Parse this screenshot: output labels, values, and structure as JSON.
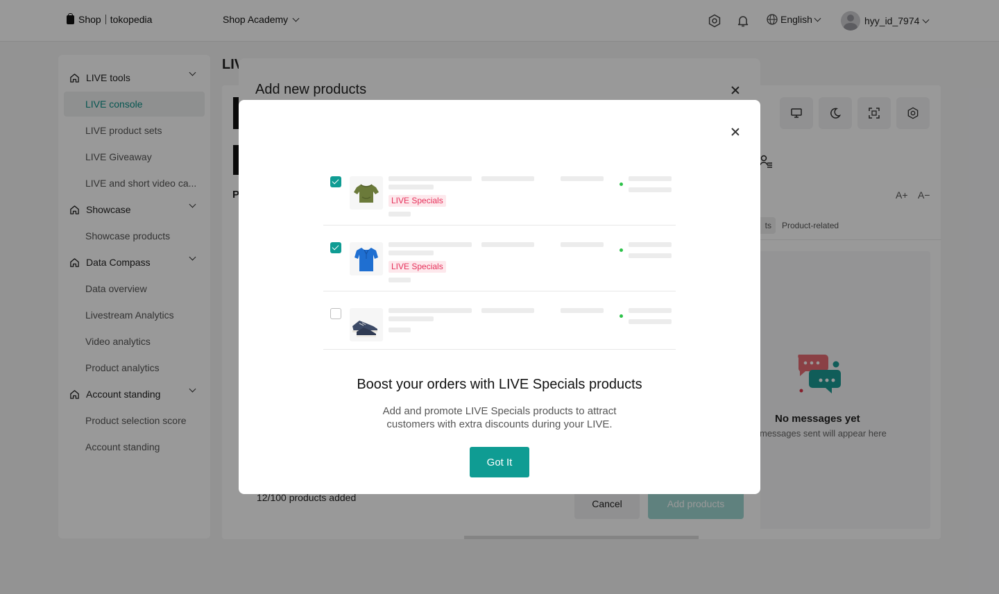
{
  "topbar": {
    "logo_shop": "Shop",
    "logo_partner": "tokopedia",
    "academy_label": "Shop Academy",
    "language": "English",
    "username": "hyy_id_7974",
    "icons": [
      "settings-icon",
      "bell-icon",
      "globe-icon",
      "avatar"
    ]
  },
  "sidebar": {
    "groups": [
      {
        "label": "LIVE tools",
        "items": [
          "LIVE console",
          "LIVE product sets",
          "LIVE Giveaway",
          "LIVE and short video ca..."
        ]
      },
      {
        "label": "Showcase",
        "items": [
          "Showcase products"
        ]
      },
      {
        "label": "Data Compass",
        "items": [
          "Data overview",
          "Livestream Analytics",
          "Video analytics",
          "Product analytics"
        ]
      },
      {
        "label": "Account standing",
        "items": [
          "Product selection score",
          "Account standing"
        ]
      }
    ],
    "active_item": "LIVE console"
  },
  "page": {
    "title_partial": "LIV",
    "left_letter": "P",
    "font_increase": "A+",
    "font_decrease": "A−",
    "tab_partial": "ts",
    "tab_product_related": "Product-related",
    "no_messages_title": "No messages yet",
    "no_messages_sub": "messages sent will appear here"
  },
  "dialog": {
    "title": "Add new products",
    "added_count": "12/100 products added",
    "cancel_label": "Cancel",
    "add_label": "Add products"
  },
  "modal": {
    "rows": [
      {
        "checked": true,
        "image": "green-tshirt",
        "tag": "LIVE Specials"
      },
      {
        "checked": true,
        "image": "blue-polo-shirt",
        "tag": "LIVE Specials"
      },
      {
        "checked": false,
        "image": "sneakers",
        "tag": ""
      }
    ],
    "title": "Boost your orders with LIVE Specials products",
    "description": "Add and promote LIVE Specials products to attract customers with extra discounts during your LIVE.",
    "button_label": "Got It"
  },
  "colors": {
    "accent": "#0f9c93",
    "tag_text": "#e6305a",
    "tag_bg": "#fde8ec",
    "status_dot": "#2dc24a"
  }
}
